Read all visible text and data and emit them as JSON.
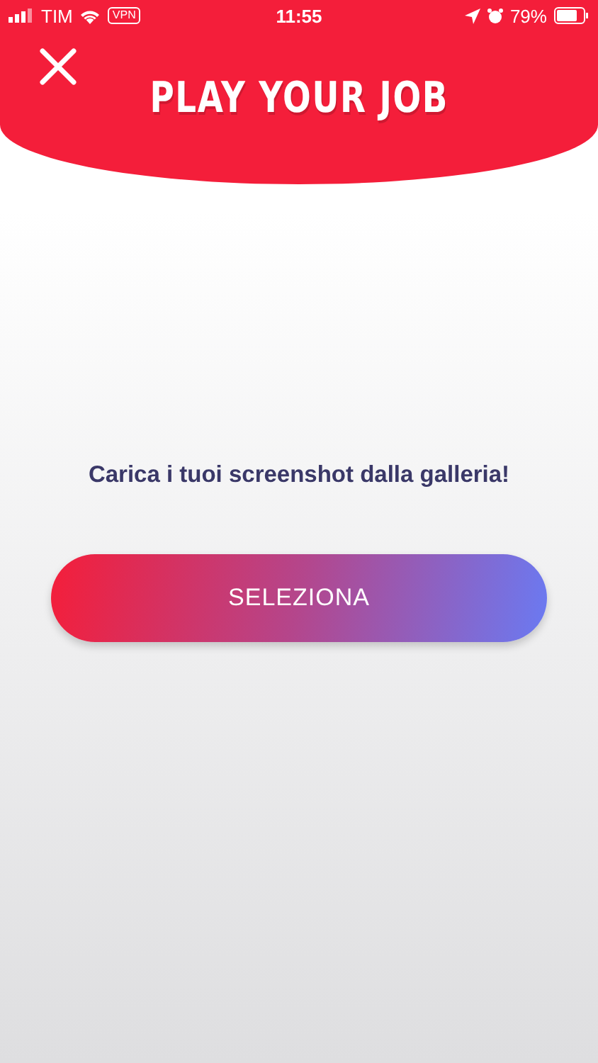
{
  "status_bar": {
    "carrier": "TIM",
    "vpn": "VPN",
    "time": "11:55",
    "battery": "79%"
  },
  "header": {
    "title": "PLAY YOUR JOB"
  },
  "prompt": "Carica i tuoi screenshot dalla galleria!",
  "button": {
    "label": "SELEZIONA"
  }
}
